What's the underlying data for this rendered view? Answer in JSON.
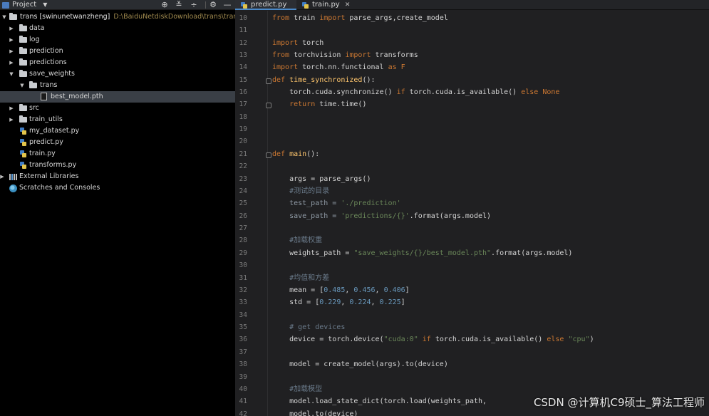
{
  "project_panel": {
    "title": "Project",
    "toolbar_icons": [
      "target-icon",
      "collapse-all-icon",
      "expand-icon",
      "gear-icon",
      "minimize-icon"
    ],
    "tree": [
      {
        "label": "trans [swinunetwanzheng]",
        "path": "D:\\BaiduNetdiskDownload\\trans\\trans",
        "type": "folder",
        "expanded": true
      },
      {
        "label": "data",
        "type": "folder",
        "expanded": false
      },
      {
        "label": "log",
        "type": "folder",
        "expanded": false
      },
      {
        "label": "prediction",
        "type": "folder",
        "expanded": false
      },
      {
        "label": "predictions",
        "type": "folder",
        "expanded": false
      },
      {
        "label": "save_weights",
        "type": "folder",
        "expanded": true
      },
      {
        "label": "trans",
        "type": "folder",
        "expanded": true
      },
      {
        "label": "best_model.pth",
        "type": "file",
        "selected": true
      },
      {
        "label": "src",
        "type": "folder",
        "expanded": false
      },
      {
        "label": "train_utils",
        "type": "folder",
        "expanded": false
      },
      {
        "label": "my_dataset.py",
        "type": "python-file"
      },
      {
        "label": "predict.py",
        "type": "python-file"
      },
      {
        "label": "train.py",
        "type": "python-file"
      },
      {
        "label": "transforms.py",
        "type": "python-file"
      },
      {
        "label": "External Libraries",
        "type": "library",
        "expanded": false
      },
      {
        "label": "Scratches and Consoles",
        "type": "scratches"
      }
    ]
  },
  "editor": {
    "tabs": [
      {
        "label": "predict.py",
        "active": true
      },
      {
        "label": "train.py",
        "active": false
      }
    ],
    "line_numbers": [
      "10",
      "11",
      "12",
      "13",
      "14",
      "15",
      "16",
      "17",
      "18",
      "19",
      "20",
      "21",
      "22",
      "23",
      "24",
      "25",
      "26",
      "27",
      "28",
      "29",
      "30",
      "31",
      "32",
      "33",
      "34",
      "35",
      "36",
      "37",
      "38",
      "39",
      "40",
      "41",
      "42"
    ],
    "code": {
      "l10": {
        "t1": "from",
        "t2": " train ",
        "t3": "import",
        "t4": " parse_args,create_model"
      },
      "l12": {
        "t1": "import",
        "t2": " torch"
      },
      "l13": {
        "t1": "from",
        "t2": " torchvision ",
        "t3": "import",
        "t4": " transforms"
      },
      "l14": {
        "t1": "import",
        "t2": " torch.nn.functional ",
        "t3": "as",
        "t4": " F"
      },
      "l15": {
        "t1": "def",
        "t2": " ",
        "t3": "time_synchronized",
        "t4": "():"
      },
      "l16": {
        "t1": "    torch.cuda.synchronize() ",
        "t2": "if",
        "t3": " torch.cuda.is_available() ",
        "t4": "else",
        "t5": " None"
      },
      "l17": {
        "t1": "    ",
        "t2": "return",
        "t3": " time.time()"
      },
      "l21": {
        "t1": "def",
        "t2": " ",
        "t3": "main",
        "t4": "():"
      },
      "l23": {
        "t1": "    args = parse_args()"
      },
      "l24": {
        "t1": "    #测试的目录"
      },
      "l25": {
        "t1": "    test_path = ",
        "t2": "'./prediction'"
      },
      "l26": {
        "t1": "    save_path = ",
        "t2": "'predictions/{}'",
        "t3": ".format(args.model)"
      },
      "l28": {
        "t1": "    #加载权重"
      },
      "l29": {
        "t1": "    weights_path = ",
        "t2": "\"save_weights/{}/best_model.pth\"",
        "t3": ".format(args.model)"
      },
      "l31": {
        "t1": "    #均值和方差"
      },
      "l32": {
        "t1": "    mean = [",
        "t2": "0.485",
        "t3": ", ",
        "t4": "0.456",
        "t5": ", ",
        "t6": "0.406",
        "t7": "]"
      },
      "l33": {
        "t1": "    std = [",
        "t2": "0.229",
        "t3": ", ",
        "t4": "0.224",
        "t5": ", ",
        "t6": "0.225",
        "t7": "]"
      },
      "l35": {
        "t1": "    # get devices"
      },
      "l36": {
        "t1": "    device = torch.device(",
        "t2": "\"cuda:0\"",
        "t3": " ",
        "t4": "if",
        "t5": " torch.cuda.is_available() ",
        "t6": "else",
        "t7": " ",
        "t8": "\"cpu\"",
        "t9": ")"
      },
      "l38": {
        "t1": "    model = create_model(args).to(device)"
      },
      "l40": {
        "t1": "    #加载模型"
      },
      "l41": {
        "t1": "    model.load_state_dict(torch.load(weights_path,"
      },
      "l42": {
        "t1": "    model.to(device)"
      }
    }
  },
  "watermark": "CSDN @计算机C9硕士_算法工程师",
  "colors": {
    "keyword": "#cc7832",
    "function": "#ffc66d",
    "string": "#6a8759",
    "number": "#6897bb",
    "comment": "#6a7a8a",
    "editor_bg": "#202022"
  }
}
